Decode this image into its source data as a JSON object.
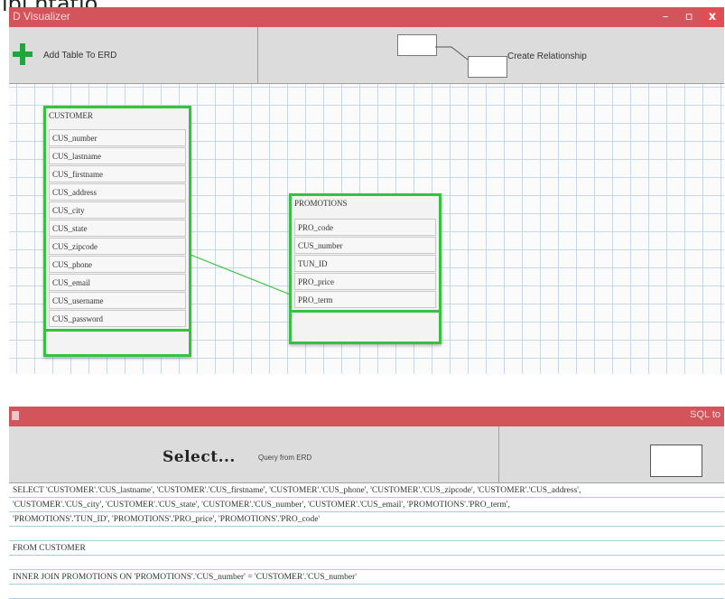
{
  "page_top_fragment": "ipl  ntatio",
  "erd_window": {
    "title": "D Visualizer",
    "controls": {
      "minimize": "–",
      "maximize": "▫",
      "close": "x"
    },
    "toolbar": {
      "add_table_label": "Add Table To ERD",
      "create_relationship_label": "Create Relationship"
    },
    "tables": [
      {
        "name": "CUSTOMER",
        "fields": [
          "CUS_number",
          "CUS_lastname",
          "CUS_firstname",
          "CUS_address",
          "CUS_city",
          "CUS_state",
          "CUS_zipcode",
          "CUS_phone",
          "CUS_email",
          "CUS_username",
          "CUS_password"
        ]
      },
      {
        "name": "PROMOTIONS",
        "fields": [
          "PRO_code",
          "CUS_number",
          "TUN_ID",
          "PRO_price",
          "PRO_term"
        ]
      }
    ],
    "relationship": {
      "from": "CUSTOMER",
      "to": "PROMOTIONS"
    }
  },
  "sql_window": {
    "title": "SQL to",
    "toolbar": {
      "select_label": "Select...",
      "query_source_label": "Query from ERD"
    },
    "sql_lines": [
      "SELECT 'CUSTOMER'.'CUS_lastname', 'CUSTOMER'.'CUS_firstname', 'CUSTOMER'.'CUS_phone', 'CUSTOMER'.'CUS_zipcode', 'CUSTOMER'.'CUS_address',",
      "'CUSTOMER'.'CUS_city', 'CUSTOMER'.'CUS_state', 'CUSTOMER'.'CUS_number', 'CUSTOMER'.'CUS_email', 'PROMOTIONS'.'PRO_term',",
      "'PROMOTIONS'.'TUN_ID', 'PROMOTIONS'.'PRO_price', 'PROMOTIONS'.'PRO_code'",
      "",
      "FROM CUSTOMER",
      "",
      "INNER JOIN PROMOTIONS ON 'PROMOTIONS'.'CUS_number' = 'CUSTOMER'.'CUS_number'"
    ]
  },
  "colors": {
    "titlebar": "#d4545c",
    "table_border": "#35c33f",
    "add_icon": "#1fa83a",
    "relationship_line": "#35c33f"
  }
}
